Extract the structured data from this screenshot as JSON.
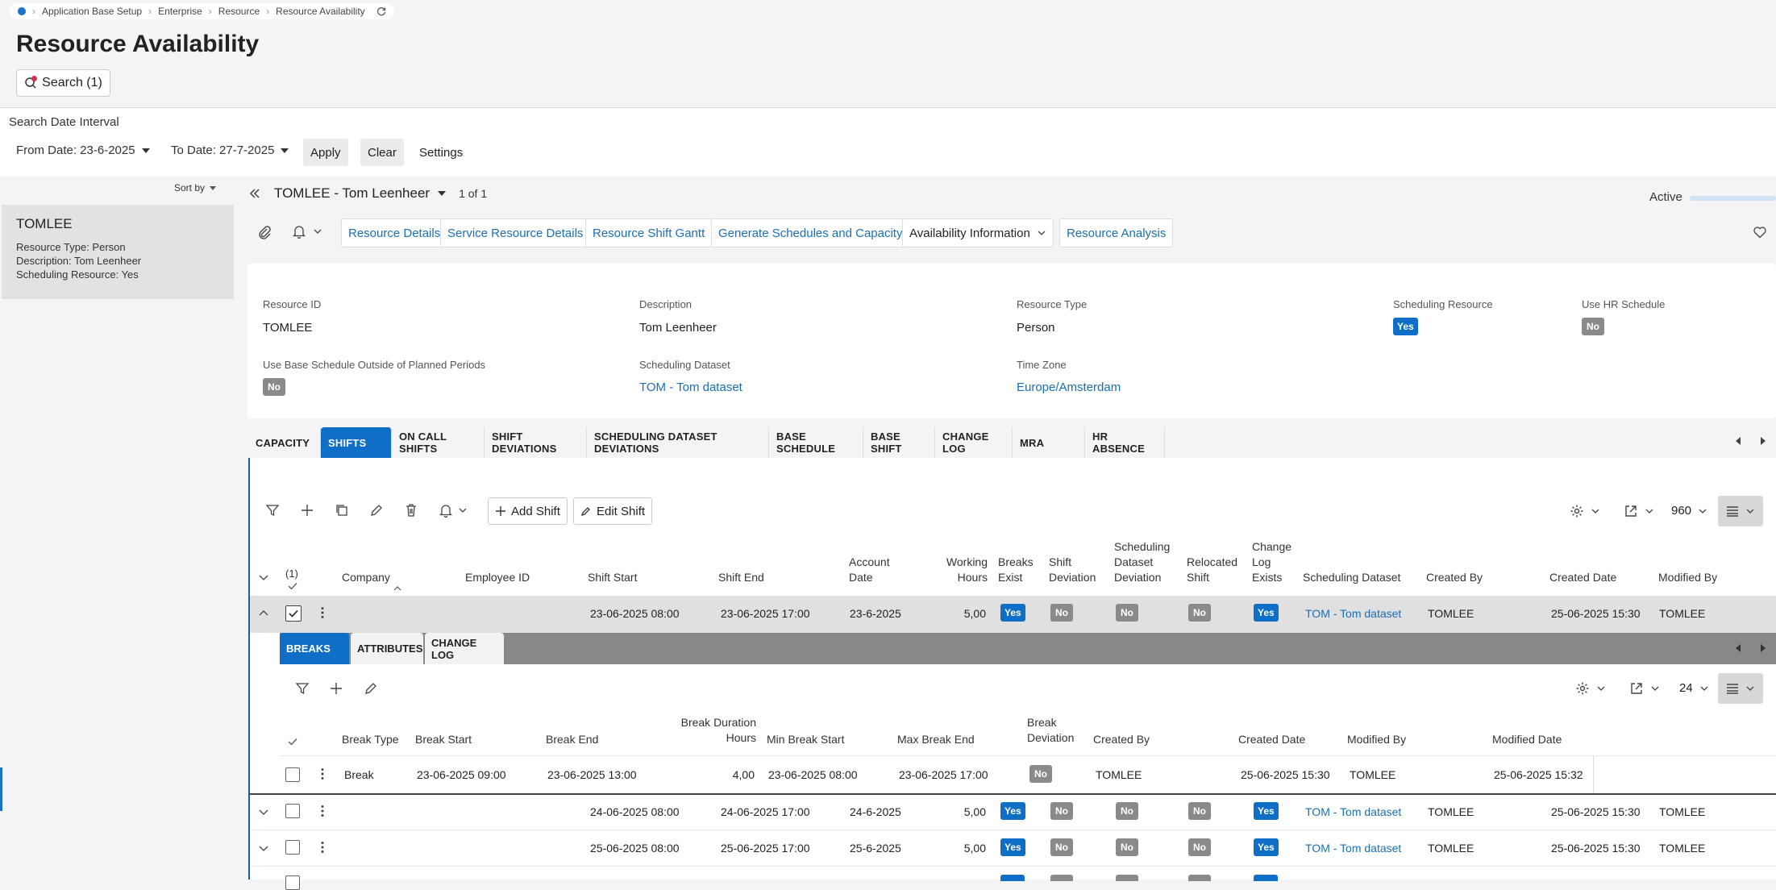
{
  "breadcrumb": {
    "items": [
      "Application Base Setup",
      "Enterprise",
      "Resource",
      "Resource Availability"
    ]
  },
  "page": {
    "title": "Resource Availability",
    "search_label": "Search (1)"
  },
  "filter": {
    "section_label": "Search Date Interval",
    "from_date": "From Date: 23-6-2025",
    "to_date": "To Date: 27-7-2025",
    "apply": "Apply",
    "clear": "Clear",
    "settings": "Settings"
  },
  "list": {
    "sort_label": "Sort by",
    "card": {
      "title": "TOMLEE",
      "resource_type": "Resource Type:  Person",
      "description": "Description:  Tom Leenheer",
      "scheduling_resource": "Scheduling Resource:  Yes"
    }
  },
  "record": {
    "name": "TOMLEE - Tom Leenheer",
    "count": "1 of 1",
    "status": "Active"
  },
  "toolbar": {
    "buttons": [
      "Resource Details",
      "Service Resource Details",
      "Resource Shift Gantt",
      "Generate Schedules and Capacity",
      "Availability Information",
      "Resource Analysis"
    ]
  },
  "details": {
    "resource_id_label": "Resource ID",
    "resource_id": "TOMLEE",
    "description_label": "Description",
    "description": "Tom Leenheer",
    "resource_type_label": "Resource Type",
    "resource_type": "Person",
    "scheduling_resource_label": "Scheduling Resource",
    "scheduling_resource": "Yes",
    "use_hr_schedule_label": "Use HR Schedule",
    "use_hr_schedule": "No",
    "use_base_schedule_label": "Use Base Schedule Outside of Planned Periods",
    "use_base_schedule": "No",
    "scheduling_dataset_label": "Scheduling Dataset",
    "scheduling_dataset": "TOM - Tom dataset",
    "time_zone_label": "Time Zone",
    "time_zone": "Europe/Amsterdam"
  },
  "tabs": [
    "CAPACITY",
    "SHIFTS",
    "ON CALL SHIFTS",
    "SHIFT DEVIATIONS",
    "SCHEDULING DATASET DEVIATIONS",
    "BASE SCHEDULE",
    "BASE SHIFT",
    "CHANGE LOG",
    "MRA",
    "HR ABSENCE"
  ],
  "grid": {
    "add_shift": "Add Shift",
    "edit_shift": "Edit Shift",
    "page_size": "960",
    "selected_count": "(1)",
    "columns": {
      "company": "Company",
      "employee_id": "Employee ID",
      "shift_start": "Shift Start",
      "shift_end": "Shift End",
      "account_date": "Account Date",
      "working_hours": "Working Hours",
      "breaks_exist": "Breaks Exist",
      "shift_deviation": "Shift Deviation",
      "sched_dataset_deviation": "Scheduling Dataset Deviation",
      "relocated_shift": "Relocated Shift",
      "change_log_exists": "Change Log Exists",
      "scheduling_dataset": "Scheduling Dataset",
      "created_by": "Created By",
      "created_date": "Created Date",
      "modified_by": "Modified By"
    },
    "rows": [
      {
        "shift_start": "23-06-2025 08:00",
        "shift_end": "23-06-2025 17:00",
        "account_date": "23-6-2025",
        "working_hours": "5,00",
        "breaks_exist": "Yes",
        "shift_deviation": "No",
        "sched_dataset_deviation": "No",
        "relocated_shift": "No",
        "change_log_exists": "Yes",
        "scheduling_dataset": "TOM - Tom dataset",
        "created_by": "TOMLEE",
        "created_date": "25-06-2025 15:30",
        "modified_by": "TOMLEE"
      },
      {
        "shift_start": "24-06-2025 08:00",
        "shift_end": "24-06-2025 17:00",
        "account_date": "24-6-2025",
        "working_hours": "5,00",
        "breaks_exist": "Yes",
        "shift_deviation": "No",
        "sched_dataset_deviation": "No",
        "relocated_shift": "No",
        "change_log_exists": "Yes",
        "scheduling_dataset": "TOM - Tom dataset",
        "created_by": "TOMLEE",
        "created_date": "25-06-2025 15:30",
        "modified_by": "TOMLEE"
      },
      {
        "shift_start": "25-06-2025 08:00",
        "shift_end": "25-06-2025 17:00",
        "account_date": "25-6-2025",
        "working_hours": "5,00",
        "breaks_exist": "Yes",
        "shift_deviation": "No",
        "sched_dataset_deviation": "No",
        "relocated_shift": "No",
        "change_log_exists": "Yes",
        "scheduling_dataset": "TOM - Tom dataset",
        "created_by": "TOMLEE",
        "created_date": "25-06-2025 15:30",
        "modified_by": "TOMLEE"
      }
    ]
  },
  "subtabs": [
    "BREAKS",
    "ATTRIBUTES",
    "CHANGE LOG"
  ],
  "subgrid": {
    "page_size": "24",
    "columns": {
      "break_type": "Break Type",
      "break_start": "Break Start",
      "break_end": "Break End",
      "break_duration": "Break Duration Hours",
      "min_break_start": "Min Break Start",
      "max_break_end": "Max Break End",
      "break_deviation": "Break Deviation",
      "created_by": "Created By",
      "created_date": "Created Date",
      "modified_by": "Modified By",
      "modified_date": "Modified Date"
    },
    "row": {
      "break_type": "Break",
      "break_start": "23-06-2025 09:00",
      "break_end": "23-06-2025 13:00",
      "break_duration": "4,00",
      "min_break_start": "23-06-2025 08:00",
      "max_break_end": "23-06-2025 17:00",
      "break_deviation": "No",
      "created_by": "TOMLEE",
      "created_date": "25-06-2025 15:30",
      "modified_by": "TOMLEE",
      "modified_date": "25-06-2025 15:32"
    }
  }
}
